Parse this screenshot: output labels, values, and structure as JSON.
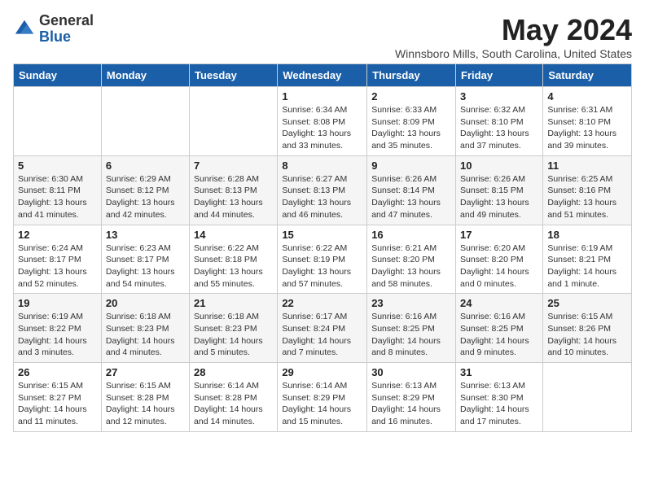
{
  "header": {
    "logo_general": "General",
    "logo_blue": "Blue",
    "month_title": "May 2024",
    "subtitle": "Winnsboro Mills, South Carolina, United States"
  },
  "weekdays": [
    "Sunday",
    "Monday",
    "Tuesday",
    "Wednesday",
    "Thursday",
    "Friday",
    "Saturday"
  ],
  "weeks": [
    [
      {
        "day": "",
        "info": ""
      },
      {
        "day": "",
        "info": ""
      },
      {
        "day": "",
        "info": ""
      },
      {
        "day": "1",
        "info": "Sunrise: 6:34 AM\nSunset: 8:08 PM\nDaylight: 13 hours\nand 33 minutes."
      },
      {
        "day": "2",
        "info": "Sunrise: 6:33 AM\nSunset: 8:09 PM\nDaylight: 13 hours\nand 35 minutes."
      },
      {
        "day": "3",
        "info": "Sunrise: 6:32 AM\nSunset: 8:10 PM\nDaylight: 13 hours\nand 37 minutes."
      },
      {
        "day": "4",
        "info": "Sunrise: 6:31 AM\nSunset: 8:10 PM\nDaylight: 13 hours\nand 39 minutes."
      }
    ],
    [
      {
        "day": "5",
        "info": "Sunrise: 6:30 AM\nSunset: 8:11 PM\nDaylight: 13 hours\nand 41 minutes."
      },
      {
        "day": "6",
        "info": "Sunrise: 6:29 AM\nSunset: 8:12 PM\nDaylight: 13 hours\nand 42 minutes."
      },
      {
        "day": "7",
        "info": "Sunrise: 6:28 AM\nSunset: 8:13 PM\nDaylight: 13 hours\nand 44 minutes."
      },
      {
        "day": "8",
        "info": "Sunrise: 6:27 AM\nSunset: 8:13 PM\nDaylight: 13 hours\nand 46 minutes."
      },
      {
        "day": "9",
        "info": "Sunrise: 6:26 AM\nSunset: 8:14 PM\nDaylight: 13 hours\nand 47 minutes."
      },
      {
        "day": "10",
        "info": "Sunrise: 6:26 AM\nSunset: 8:15 PM\nDaylight: 13 hours\nand 49 minutes."
      },
      {
        "day": "11",
        "info": "Sunrise: 6:25 AM\nSunset: 8:16 PM\nDaylight: 13 hours\nand 51 minutes."
      }
    ],
    [
      {
        "day": "12",
        "info": "Sunrise: 6:24 AM\nSunset: 8:17 PM\nDaylight: 13 hours\nand 52 minutes."
      },
      {
        "day": "13",
        "info": "Sunrise: 6:23 AM\nSunset: 8:17 PM\nDaylight: 13 hours\nand 54 minutes."
      },
      {
        "day": "14",
        "info": "Sunrise: 6:22 AM\nSunset: 8:18 PM\nDaylight: 13 hours\nand 55 minutes."
      },
      {
        "day": "15",
        "info": "Sunrise: 6:22 AM\nSunset: 8:19 PM\nDaylight: 13 hours\nand 57 minutes."
      },
      {
        "day": "16",
        "info": "Sunrise: 6:21 AM\nSunset: 8:20 PM\nDaylight: 13 hours\nand 58 minutes."
      },
      {
        "day": "17",
        "info": "Sunrise: 6:20 AM\nSunset: 8:20 PM\nDaylight: 14 hours\nand 0 minutes."
      },
      {
        "day": "18",
        "info": "Sunrise: 6:19 AM\nSunset: 8:21 PM\nDaylight: 14 hours\nand 1 minute."
      }
    ],
    [
      {
        "day": "19",
        "info": "Sunrise: 6:19 AM\nSunset: 8:22 PM\nDaylight: 14 hours\nand 3 minutes."
      },
      {
        "day": "20",
        "info": "Sunrise: 6:18 AM\nSunset: 8:23 PM\nDaylight: 14 hours\nand 4 minutes."
      },
      {
        "day": "21",
        "info": "Sunrise: 6:18 AM\nSunset: 8:23 PM\nDaylight: 14 hours\nand 5 minutes."
      },
      {
        "day": "22",
        "info": "Sunrise: 6:17 AM\nSunset: 8:24 PM\nDaylight: 14 hours\nand 7 minutes."
      },
      {
        "day": "23",
        "info": "Sunrise: 6:16 AM\nSunset: 8:25 PM\nDaylight: 14 hours\nand 8 minutes."
      },
      {
        "day": "24",
        "info": "Sunrise: 6:16 AM\nSunset: 8:25 PM\nDaylight: 14 hours\nand 9 minutes."
      },
      {
        "day": "25",
        "info": "Sunrise: 6:15 AM\nSunset: 8:26 PM\nDaylight: 14 hours\nand 10 minutes."
      }
    ],
    [
      {
        "day": "26",
        "info": "Sunrise: 6:15 AM\nSunset: 8:27 PM\nDaylight: 14 hours\nand 11 minutes."
      },
      {
        "day": "27",
        "info": "Sunrise: 6:15 AM\nSunset: 8:28 PM\nDaylight: 14 hours\nand 12 minutes."
      },
      {
        "day": "28",
        "info": "Sunrise: 6:14 AM\nSunset: 8:28 PM\nDaylight: 14 hours\nand 14 minutes."
      },
      {
        "day": "29",
        "info": "Sunrise: 6:14 AM\nSunset: 8:29 PM\nDaylight: 14 hours\nand 15 minutes."
      },
      {
        "day": "30",
        "info": "Sunrise: 6:13 AM\nSunset: 8:29 PM\nDaylight: 14 hours\nand 16 minutes."
      },
      {
        "day": "31",
        "info": "Sunrise: 6:13 AM\nSunset: 8:30 PM\nDaylight: 14 hours\nand 17 minutes."
      },
      {
        "day": "",
        "info": ""
      }
    ]
  ]
}
